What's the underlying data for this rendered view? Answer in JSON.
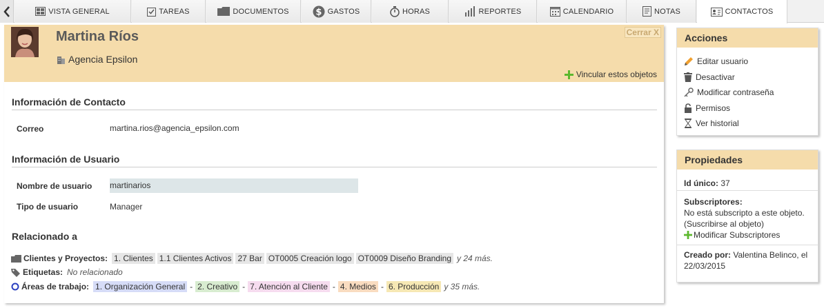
{
  "tabs": [
    {
      "label": "VISTA GENERAL",
      "icon": "dashboard-icon"
    },
    {
      "label": "TAREAS",
      "icon": "tasks-icon"
    },
    {
      "label": "DOCUMENTOS",
      "icon": "folder-icon"
    },
    {
      "label": "GASTOS",
      "icon": "money-icon"
    },
    {
      "label": "HORAS",
      "icon": "stopwatch-icon"
    },
    {
      "label": "REPORTES",
      "icon": "chart-icon"
    },
    {
      "label": "CALENDARIO",
      "icon": "calendar-icon"
    },
    {
      "label": "NOTAS",
      "icon": "notes-icon"
    },
    {
      "label": "CONTACTOS",
      "icon": "contacts-icon"
    }
  ],
  "active_tab": "CONTACTOS",
  "header": {
    "name": "Martina Ríos",
    "company": "Agencia Epsilon",
    "close_label": "Cerrar X",
    "link_label": "Vincular estos objetos"
  },
  "contact": {
    "title": "Información de Contacto",
    "email_label": "Correo",
    "email_value": "martina.rios@agencia_epsilon.com"
  },
  "user": {
    "title": "Información de Usuario",
    "username_label": "Nombre de usuario",
    "username_value": "martinarios",
    "type_label": "Tipo de usuario",
    "type_value": "Manager"
  },
  "related": {
    "title": "Relacionado a",
    "clients_label": "Clientes y Proyectos:",
    "clients": [
      "1. Clientes",
      "1.1 Clientes Activos",
      "27 Bar",
      "OT0005 Creación logo",
      "OT0009 Diseño Branding"
    ],
    "clients_more": "y 24 más.",
    "tags_label": "Etiquetas:",
    "tags_value": "No relacionado",
    "areas_label": "Áreas de trabajo:",
    "areas": [
      {
        "label": "1. Organización General",
        "color": "#d6dcf7"
      },
      {
        "label": "2. Creativo",
        "color": "#d8ecd0"
      },
      {
        "label": "7. Atención al Cliente",
        "color": "#f6dcef"
      },
      {
        "label": "4. Medios",
        "color": "#f9dcc0"
      },
      {
        "label": "6. Producción",
        "color": "#f6e8b4"
      }
    ],
    "areas_separator": "-",
    "areas_more": "y 35 más."
  },
  "actions": {
    "title": "Acciones",
    "items": [
      {
        "label": "Editar usuario",
        "icon": "pencil-icon"
      },
      {
        "label": "Desactivar",
        "icon": "trash-icon"
      },
      {
        "label": "Modificar contraseña",
        "icon": "key-icon"
      },
      {
        "label": "Permisos",
        "icon": "lock-icon"
      },
      {
        "label": "Ver historial",
        "icon": "hourglass-icon"
      }
    ]
  },
  "properties": {
    "title": "Propiedades",
    "id_label": "Id único:",
    "id_value": "37",
    "subs_label": "Subscriptores:",
    "subs_text": "No está subscripto a este objeto.",
    "subs_link": "(Suscribirse al objeto)",
    "modify_subs": "Modificar Subscriptores",
    "created_label": "Creado por:",
    "created_by": "Valentina Belinco, el",
    "created_date": "22/03/2015"
  },
  "colors": {
    "header_bg": "#f5dcab",
    "accent_green": "#5cb82e"
  }
}
